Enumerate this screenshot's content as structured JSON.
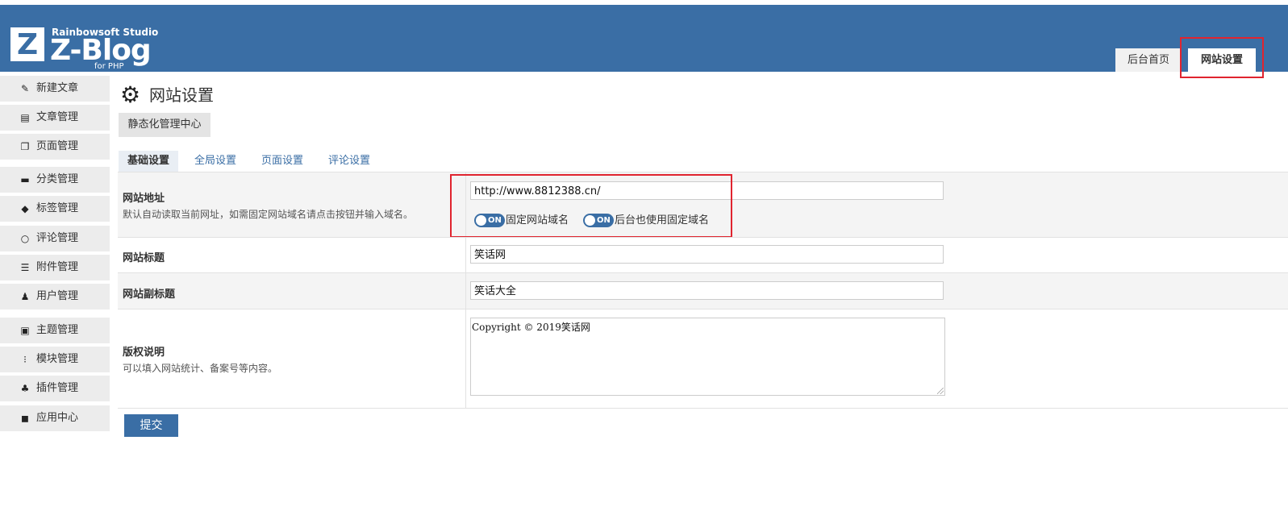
{
  "brand": {
    "logo_letter": "Z",
    "studio": "Rainbowsoft Studio",
    "name": "Z-Blog",
    "sub": "for PHP"
  },
  "top_tabs": [
    {
      "label": "后台首页"
    },
    {
      "label": "网站设置",
      "active": true
    }
  ],
  "sidebar": {
    "items": [
      {
        "label": "新建文章",
        "icon": "edit-icon"
      },
      {
        "label": "文章管理",
        "icon": "document-icon"
      },
      {
        "label": "页面管理",
        "icon": "pages-icon"
      },
      {
        "label": "分类管理",
        "icon": "folder-icon"
      },
      {
        "label": "标签管理",
        "icon": "tag-icon"
      },
      {
        "label": "评论管理",
        "icon": "comment-icon"
      },
      {
        "label": "附件管理",
        "icon": "attachment-icon"
      },
      {
        "label": "用户管理",
        "icon": "user-icon"
      },
      {
        "label": "主题管理",
        "icon": "theme-icon"
      },
      {
        "label": "模块管理",
        "icon": "module-icon"
      },
      {
        "label": "插件管理",
        "icon": "plugin-icon"
      },
      {
        "label": "应用中心",
        "icon": "app-center-icon"
      }
    ]
  },
  "main": {
    "title": "网站设置",
    "static_button": "静态化管理中心",
    "tabs": [
      {
        "label": "基础设置",
        "active": true
      },
      {
        "label": "全局设置"
      },
      {
        "label": "页面设置"
      },
      {
        "label": "评论设置"
      }
    ],
    "settings": {
      "site_url": {
        "label": "网站地址",
        "desc": "默认自动读取当前网址，如需固定网站域名请点击按钮并输入域名。",
        "value": "http://www.8812388.cn/",
        "toggle1_state": "ON",
        "toggle1_label": "固定网站域名",
        "toggle2_state": "ON",
        "toggle2_label": "后台也使用固定域名"
      },
      "site_title": {
        "label": "网站标题",
        "value": "笑话网"
      },
      "site_subtitle": {
        "label": "网站副标题",
        "value": "笑话大全"
      },
      "copyright": {
        "label": "版权说明",
        "desc": "可以填入网站统计、备案号等内容。",
        "value": "Copyright © 2019笑话网"
      }
    },
    "submit_label": "提交"
  },
  "colors": {
    "header_bg": "#3a6ea5",
    "accent": "#3a6ea5",
    "highlight_box": "#e0242f"
  }
}
